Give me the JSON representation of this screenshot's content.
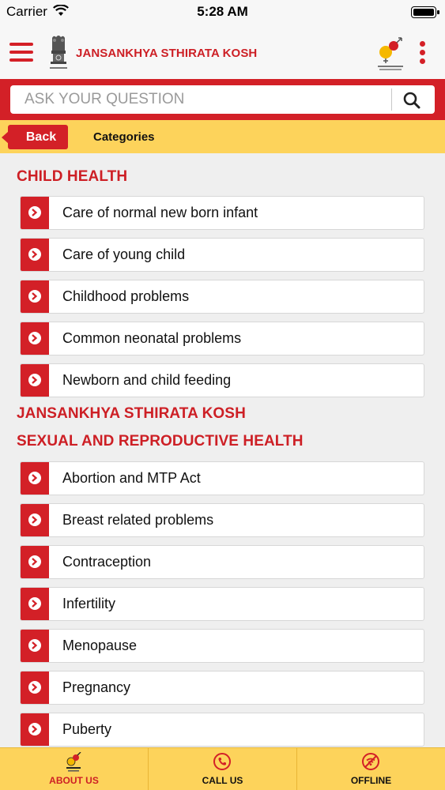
{
  "status_bar": {
    "carrier": "Carrier",
    "time": "5:28 AM"
  },
  "header": {
    "title": "JANSANKHYA STHIRATA KOSH"
  },
  "search": {
    "placeholder": "ASK YOUR QUESTION"
  },
  "category_bar": {
    "back_label": "Back",
    "title": "Categories"
  },
  "sections": [
    {
      "heading": "CHILD HEALTH",
      "items": [
        "Care of normal new born infant",
        "Care of young child",
        "Childhood problems",
        "Common neonatal problems",
        "Newborn and child feeding"
      ]
    },
    {
      "heading": "JANSANKHYA STHIRATA KOSH",
      "items": []
    },
    {
      "heading": "SEXUAL AND REPRODUCTIVE HEALTH",
      "items": [
        "Abortion and MTP Act",
        "Breast related problems",
        "Contraception",
        "Infertility",
        "Menopause",
        "Pregnancy",
        "Puberty"
      ]
    }
  ],
  "tabs": [
    {
      "label": "ABOUT US",
      "icon": "about-us-icon",
      "active": true
    },
    {
      "label": "CALL US",
      "icon": "phone-icon",
      "active": false
    },
    {
      "label": "OFFLINE",
      "icon": "offline-icon",
      "active": false
    }
  ],
  "colors": {
    "brand_red": "#d32027",
    "accent_yellow": "#fdd35b"
  }
}
